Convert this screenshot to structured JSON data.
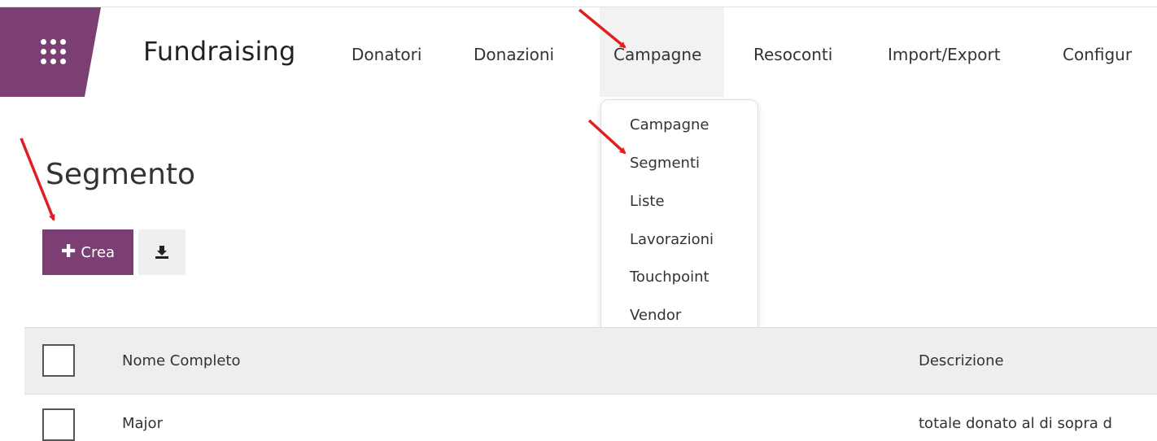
{
  "navbar": {
    "brand": "Fundraising",
    "menu": [
      {
        "label": "Donatori"
      },
      {
        "label": "Donazioni"
      },
      {
        "label": "Campagne"
      },
      {
        "label": "Resoconti"
      },
      {
        "label": "Import/Export"
      },
      {
        "label": "Configur"
      }
    ],
    "active_menu": "Campagne"
  },
  "dropdown": {
    "items": [
      {
        "label": "Campagne"
      },
      {
        "label": "Segmenti"
      },
      {
        "label": "Liste"
      },
      {
        "label": "Lavorazioni"
      },
      {
        "label": "Touchpoint"
      },
      {
        "label": "Vendor"
      }
    ]
  },
  "page": {
    "title": "Segmento",
    "create_label": "Crea",
    "create_icon": "plus-icon",
    "download_icon": "download-icon"
  },
  "table": {
    "columns": [
      "Nome Completo",
      "Descrizione"
    ],
    "rows": [
      {
        "name": "Major",
        "description": "totale donato al di sopra d"
      }
    ]
  },
  "colors": {
    "brand": "#7b3f73",
    "annotation_arrow": "#e02020"
  }
}
